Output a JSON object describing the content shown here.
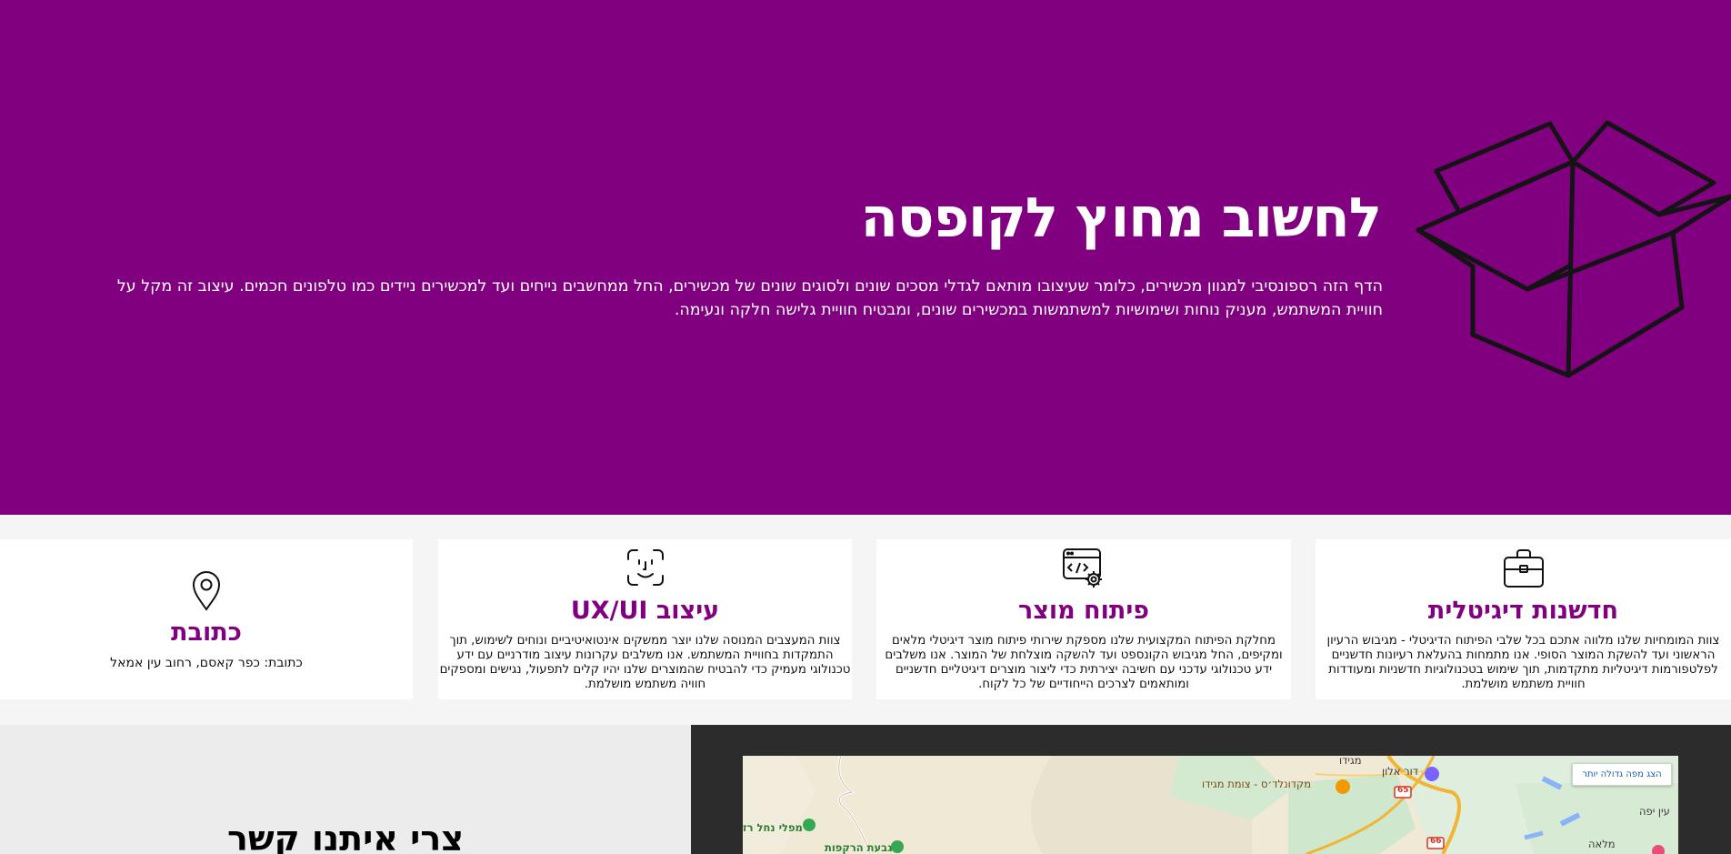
{
  "hero": {
    "title": "לחשוב מחוץ לקופסה",
    "description": "הדף הזה רספונסיבי למגוון מכשירים, כלומר שעיצובו מותאם לגדלי מסכים שונים ולסוגים שונים של מכשירים, החל ממחשבים נייחים ועד למכשירים ניידים כמו טלפונים חכמים. עיצוב זה מקל על חוויית המשתמש, מעניק נוחות ושימושיות למשתמשות במכשירים שונים, ומבטיח חוויית גלישה חלקה ונעימה.",
    "background_color": "#800080",
    "illustration_icon": "open-box-icon"
  },
  "cards": [
    {
      "icon": "briefcase-icon",
      "title": "חדשנות דיגיטלית",
      "text": "צוות המומחיות שלנו מלווה אתכם בכל שלבי הפיתוח הדיגיטלי - מגיבוש הרעיון הראשוני ועד להשקת המוצר הסופי. אנו מתמחות בהעלאת רעיונות חדשניים לפלטפורמות דיגיטליות מתקדמות, תוך שימוש בטכנולוגיות חדשניות ומעודדות חוויית משתמש מושלמת."
    },
    {
      "icon": "code-settings-icon",
      "title": "פיתוח מוצר",
      "text": "מחלקת הפיתוח המקצועית שלנו מספקת שירותי פיתוח מוצר דיגיטלי מלאים ומקיפים, החל מגיבוש הקונספט ועד להשקה מוצלחת של המוצר. אנו משלבים ידע טכנולוגי עדכני עם חשיבה יצירתית כדי ליצור מוצרים דיגיטליים חדשניים ומותאמים לצרכים הייחודיים של כל לקוח."
    },
    {
      "icon": "face-scan-icon",
      "title": "עיצוב UX/UI",
      "text": "צוות המעצבים המנוסה שלנו יוצר ממשקים אינטואיטיביים ונוחים לשימוש, תוך התמקדות בחוויית המשתמש. אנו משלבים עקרונות עיצוב מודרניים עם ידע טכנולוגי מעמיק כדי להבטיח שהמוצרים שלנו יהיו קלים לתפעול, נגישים ומספקים חוויה משתמש מושלמת."
    },
    {
      "icon": "map-pin-icon",
      "title": "כתובת",
      "text": "כתובת: כפר קאסם, רחוב עין אמאל"
    }
  ],
  "contact": {
    "title": "צרי איתנו קשר"
  },
  "map": {
    "view_larger_button": "הצג מפה גדולה יותר",
    "labels": {
      "megiddo": "מגידו",
      "dor_alon": "דור אלון",
      "mcdonalds": "מקדונלד׳ס - צומת מגידו",
      "nahal_park": "מפלי נחל רז",
      "hill": "גבעת הרקפות",
      "ein_yafe": "עין יפה",
      "mla": "מלאה",
      "road_65": "65",
      "road_66": "66"
    }
  }
}
